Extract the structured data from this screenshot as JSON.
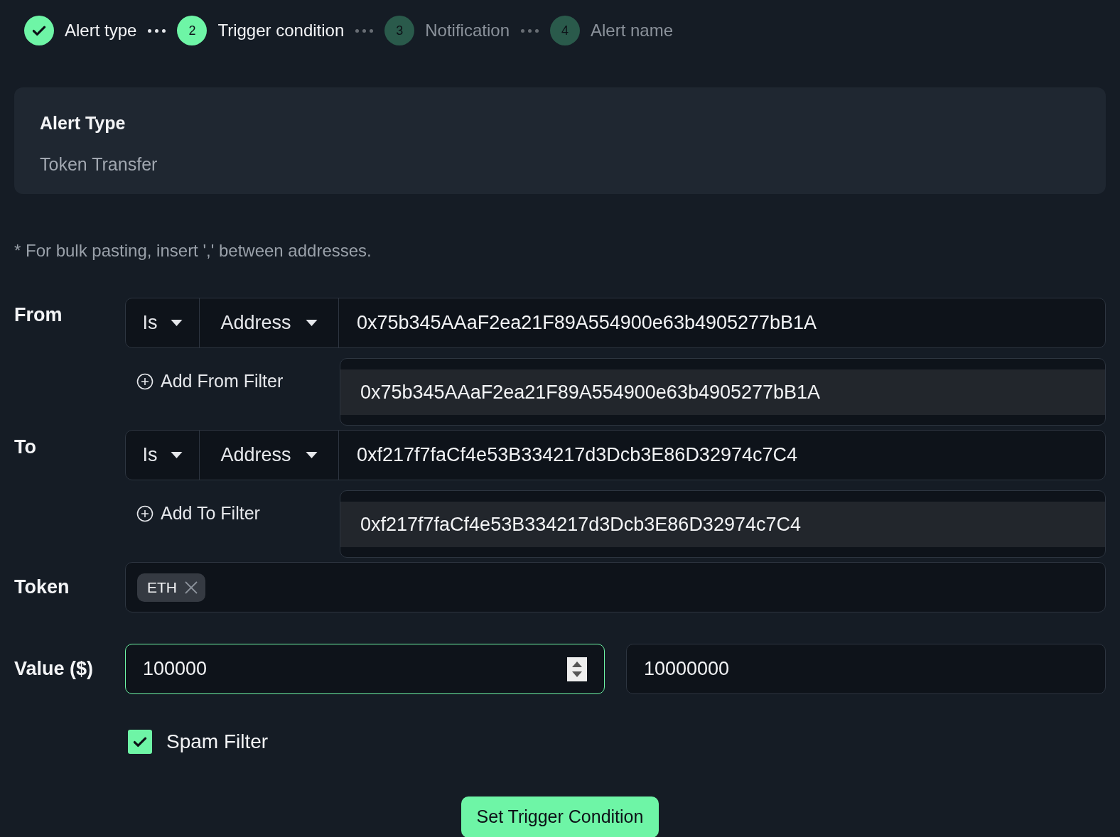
{
  "steps": [
    {
      "label": "Alert type",
      "kind": "done"
    },
    {
      "number": "2",
      "label": "Trigger condition",
      "kind": "active"
    },
    {
      "number": "3",
      "label": "Notification",
      "kind": "pending"
    },
    {
      "number": "4",
      "label": "Alert name",
      "kind": "pending"
    }
  ],
  "alert_type": {
    "title": "Alert Type",
    "value": "Token Transfer"
  },
  "note": "* For bulk pasting, insert ',' between addresses.",
  "filters": [
    {
      "label": "From",
      "operator": "Is",
      "type": "Address",
      "value": "0x75b345AAaF2ea21F89A554900e63b4905277bB1A",
      "add_label": "Add From Filter",
      "suggestion": "0x75b345AAaF2ea21F89A554900e63b4905277bB1A"
    },
    {
      "label": "To",
      "operator": "Is",
      "type": "Address",
      "value": "0xf217f7faCf4e53B334217d3Dcb3E86D32974c7C4",
      "add_label": "Add To Filter",
      "suggestion": "0xf217f7faCf4e53B334217d3Dcb3E86D32974c7C4"
    }
  ],
  "token": {
    "label": "Token",
    "tags": [
      "ETH"
    ]
  },
  "value": {
    "label": "Value ($)",
    "inputs": [
      {
        "value": "100000",
        "focused": true
      },
      {
        "value": "10000000",
        "focused": false
      }
    ]
  },
  "spam_filter": {
    "label": "Spam Filter",
    "checked": true
  },
  "submit": "Set Trigger Condition"
}
